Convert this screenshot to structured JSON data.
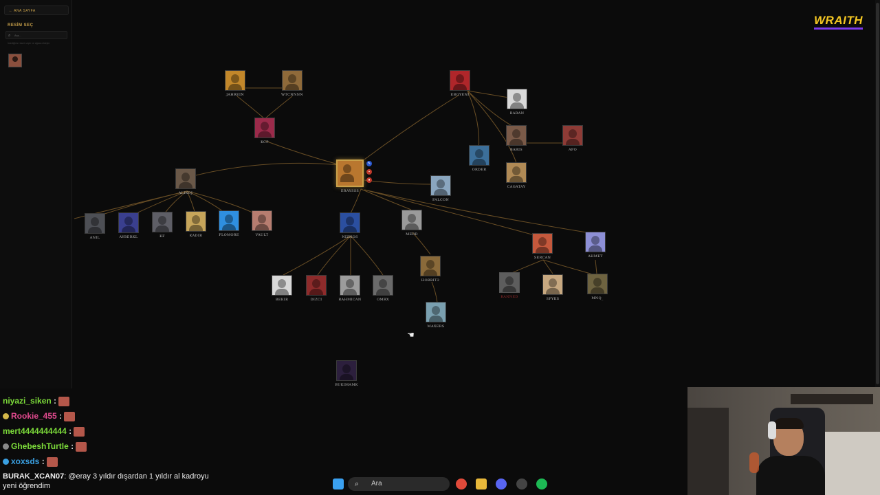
{
  "sidebar": {
    "back_label": "← ANA SAYFA",
    "title": "RESİM SEÇ",
    "search_placeholder": "Ara...",
    "hint": "İstediğiniz resmi seçin ve ağaca ekleyin"
  },
  "brand": {
    "logo": "WRAITH"
  },
  "nodes": [
    {
      "id": "eraysss",
      "name": "ERAYSSS",
      "color": "#b9772f",
      "main": true
    },
    {
      "id": "jahrein",
      "name": "JAHREIN",
      "color": "#c2872a"
    },
    {
      "id": "wtcn",
      "name": "WTCNNNN",
      "color": "#8f6a3a"
    },
    {
      "id": "kcp",
      "name": "KCP",
      "color": "#9b2a4a"
    },
    {
      "id": "eboyeni",
      "name": "EBOYENI",
      "color": "#b0262a"
    },
    {
      "id": "baran",
      "name": "BARAN",
      "color": "#d9d9d9"
    },
    {
      "id": "baris",
      "name": "BARIS",
      "color": "#7a5a48"
    },
    {
      "id": "apo",
      "name": "APO",
      "color": "#8e3b36"
    },
    {
      "id": "order",
      "name": "ORDER",
      "color": "#3c6f9a"
    },
    {
      "id": "cagatay",
      "name": "CAGATAY",
      "color": "#b08a55"
    },
    {
      "id": "falcon",
      "name": "FALCON",
      "color": "#8aa6bf"
    },
    {
      "id": "alikoj",
      "name": "ALIKOJ",
      "color": "#6a5848"
    },
    {
      "id": "anil",
      "name": "ANIL",
      "color": "#4d4f55"
    },
    {
      "id": "ayberkl",
      "name": "AYBERKL",
      "color": "#3a3f8f"
    },
    {
      "id": "kf",
      "name": "KF",
      "color": "#5e5e66"
    },
    {
      "id": "kadir",
      "name": "KADIR",
      "color": "#c6a55a"
    },
    {
      "id": "flomore",
      "name": "FLOMORE",
      "color": "#2f8fe0"
    },
    {
      "id": "vault",
      "name": "VAULT",
      "color": "#b77d70"
    },
    {
      "id": "niznos",
      "name": "NIZNOS",
      "color": "#2b4fa0"
    },
    {
      "id": "merd",
      "name": "MERD",
      "color": "#9a9a9a"
    },
    {
      "id": "bekir",
      "name": "BEKIR",
      "color": "#d8d8d8"
    },
    {
      "id": "dizci",
      "name": "DIZCI",
      "color": "#8e2b2b"
    },
    {
      "id": "rahmican",
      "name": "RAHMICAN",
      "color": "#9c9c9c"
    },
    {
      "id": "omrx",
      "name": "OMRX",
      "color": "#6a6a6a"
    },
    {
      "id": "hobbit2",
      "name": "HOBBIT2",
      "color": "#8a6a3a"
    },
    {
      "id": "maxers",
      "name": "MAXERS",
      "color": "#7aa0b0"
    },
    {
      "id": "sercan",
      "name": "SERCAN",
      "color": "#c4583c"
    },
    {
      "id": "ahmet",
      "name": "AHMET",
      "color": "#8d8fd6"
    },
    {
      "id": "dim",
      "name": "BANNED",
      "color": "#5d5d5d",
      "dim": true
    },
    {
      "id": "spyks",
      "name": "SPYKS",
      "color": "#c7a880"
    },
    {
      "id": "mnq",
      "name": "MNQ_",
      "color": "#6e6340"
    },
    {
      "id": "bukimamk",
      "name": "BUKIMAMK",
      "color": "#2c1f3d"
    }
  ],
  "chat": {
    "rows": [
      {
        "user": "niyazi_siken",
        "color": "#7ddc3a",
        "badge": ""
      },
      {
        "user": "Rookie_455",
        "color": "#e24a8f",
        "badge": "#d4b84a"
      },
      {
        "user": "mert4444444444",
        "color": "#7ddc3a",
        "badge": ""
      },
      {
        "user": "GhebeshTurtle",
        "color": "#7ddc3a",
        "badge": "#888"
      },
      {
        "user": "xoxsds",
        "color": "#3aa0e2",
        "badge": "#3aa0e2"
      }
    ],
    "message_user": "BURAK_XCAN07",
    "message_text": ": @eray 3 yıldır dışardan 1 yıldır al kadroyu yeni öğrendim"
  },
  "taskbar": {
    "search_placeholder": "Ara"
  }
}
